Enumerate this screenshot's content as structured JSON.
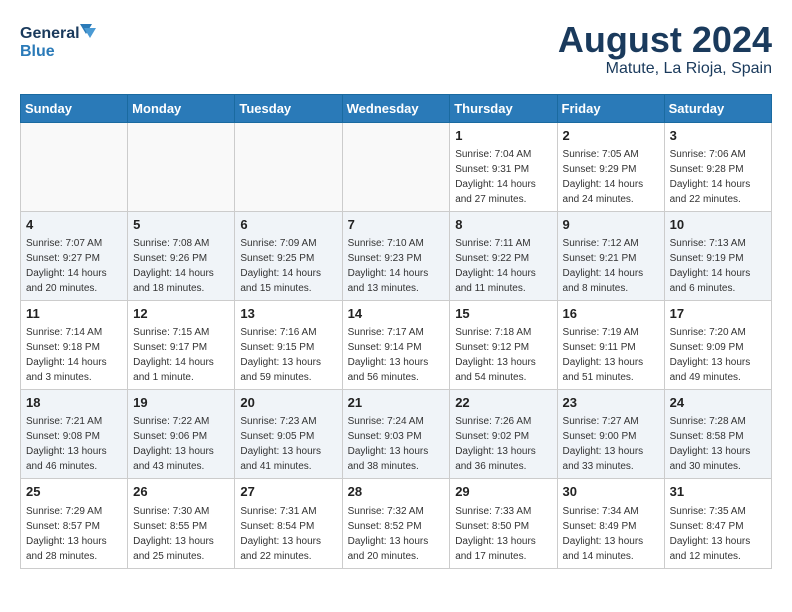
{
  "header": {
    "logo_general": "General",
    "logo_blue": "Blue",
    "month_year": "August 2024",
    "location": "Matute, La Rioja, Spain"
  },
  "weekdays": [
    "Sunday",
    "Monday",
    "Tuesday",
    "Wednesday",
    "Thursday",
    "Friday",
    "Saturday"
  ],
  "weeks": [
    [
      {
        "day": "",
        "sunrise": "",
        "sunset": "",
        "daylight": ""
      },
      {
        "day": "",
        "sunrise": "",
        "sunset": "",
        "daylight": ""
      },
      {
        "day": "",
        "sunrise": "",
        "sunset": "",
        "daylight": ""
      },
      {
        "day": "",
        "sunrise": "",
        "sunset": "",
        "daylight": ""
      },
      {
        "day": "1",
        "sunrise": "Sunrise: 7:04 AM",
        "sunset": "Sunset: 9:31 PM",
        "daylight": "Daylight: 14 hours and 27 minutes."
      },
      {
        "day": "2",
        "sunrise": "Sunrise: 7:05 AM",
        "sunset": "Sunset: 9:29 PM",
        "daylight": "Daylight: 14 hours and 24 minutes."
      },
      {
        "day": "3",
        "sunrise": "Sunrise: 7:06 AM",
        "sunset": "Sunset: 9:28 PM",
        "daylight": "Daylight: 14 hours and 22 minutes."
      }
    ],
    [
      {
        "day": "4",
        "sunrise": "Sunrise: 7:07 AM",
        "sunset": "Sunset: 9:27 PM",
        "daylight": "Daylight: 14 hours and 20 minutes."
      },
      {
        "day": "5",
        "sunrise": "Sunrise: 7:08 AM",
        "sunset": "Sunset: 9:26 PM",
        "daylight": "Daylight: 14 hours and 18 minutes."
      },
      {
        "day": "6",
        "sunrise": "Sunrise: 7:09 AM",
        "sunset": "Sunset: 9:25 PM",
        "daylight": "Daylight: 14 hours and 15 minutes."
      },
      {
        "day": "7",
        "sunrise": "Sunrise: 7:10 AM",
        "sunset": "Sunset: 9:23 PM",
        "daylight": "Daylight: 14 hours and 13 minutes."
      },
      {
        "day": "8",
        "sunrise": "Sunrise: 7:11 AM",
        "sunset": "Sunset: 9:22 PM",
        "daylight": "Daylight: 14 hours and 11 minutes."
      },
      {
        "day": "9",
        "sunrise": "Sunrise: 7:12 AM",
        "sunset": "Sunset: 9:21 PM",
        "daylight": "Daylight: 14 hours and 8 minutes."
      },
      {
        "day": "10",
        "sunrise": "Sunrise: 7:13 AM",
        "sunset": "Sunset: 9:19 PM",
        "daylight": "Daylight: 14 hours and 6 minutes."
      }
    ],
    [
      {
        "day": "11",
        "sunrise": "Sunrise: 7:14 AM",
        "sunset": "Sunset: 9:18 PM",
        "daylight": "Daylight: 14 hours and 3 minutes."
      },
      {
        "day": "12",
        "sunrise": "Sunrise: 7:15 AM",
        "sunset": "Sunset: 9:17 PM",
        "daylight": "Daylight: 14 hours and 1 minute."
      },
      {
        "day": "13",
        "sunrise": "Sunrise: 7:16 AM",
        "sunset": "Sunset: 9:15 PM",
        "daylight": "Daylight: 13 hours and 59 minutes."
      },
      {
        "day": "14",
        "sunrise": "Sunrise: 7:17 AM",
        "sunset": "Sunset: 9:14 PM",
        "daylight": "Daylight: 13 hours and 56 minutes."
      },
      {
        "day": "15",
        "sunrise": "Sunrise: 7:18 AM",
        "sunset": "Sunset: 9:12 PM",
        "daylight": "Daylight: 13 hours and 54 minutes."
      },
      {
        "day": "16",
        "sunrise": "Sunrise: 7:19 AM",
        "sunset": "Sunset: 9:11 PM",
        "daylight": "Daylight: 13 hours and 51 minutes."
      },
      {
        "day": "17",
        "sunrise": "Sunrise: 7:20 AM",
        "sunset": "Sunset: 9:09 PM",
        "daylight": "Daylight: 13 hours and 49 minutes."
      }
    ],
    [
      {
        "day": "18",
        "sunrise": "Sunrise: 7:21 AM",
        "sunset": "Sunset: 9:08 PM",
        "daylight": "Daylight: 13 hours and 46 minutes."
      },
      {
        "day": "19",
        "sunrise": "Sunrise: 7:22 AM",
        "sunset": "Sunset: 9:06 PM",
        "daylight": "Daylight: 13 hours and 43 minutes."
      },
      {
        "day": "20",
        "sunrise": "Sunrise: 7:23 AM",
        "sunset": "Sunset: 9:05 PM",
        "daylight": "Daylight: 13 hours and 41 minutes."
      },
      {
        "day": "21",
        "sunrise": "Sunrise: 7:24 AM",
        "sunset": "Sunset: 9:03 PM",
        "daylight": "Daylight: 13 hours and 38 minutes."
      },
      {
        "day": "22",
        "sunrise": "Sunrise: 7:26 AM",
        "sunset": "Sunset: 9:02 PM",
        "daylight": "Daylight: 13 hours and 36 minutes."
      },
      {
        "day": "23",
        "sunrise": "Sunrise: 7:27 AM",
        "sunset": "Sunset: 9:00 PM",
        "daylight": "Daylight: 13 hours and 33 minutes."
      },
      {
        "day": "24",
        "sunrise": "Sunrise: 7:28 AM",
        "sunset": "Sunset: 8:58 PM",
        "daylight": "Daylight: 13 hours and 30 minutes."
      }
    ],
    [
      {
        "day": "25",
        "sunrise": "Sunrise: 7:29 AM",
        "sunset": "Sunset: 8:57 PM",
        "daylight": "Daylight: 13 hours and 28 minutes."
      },
      {
        "day": "26",
        "sunrise": "Sunrise: 7:30 AM",
        "sunset": "Sunset: 8:55 PM",
        "daylight": "Daylight: 13 hours and 25 minutes."
      },
      {
        "day": "27",
        "sunrise": "Sunrise: 7:31 AM",
        "sunset": "Sunset: 8:54 PM",
        "daylight": "Daylight: 13 hours and 22 minutes."
      },
      {
        "day": "28",
        "sunrise": "Sunrise: 7:32 AM",
        "sunset": "Sunset: 8:52 PM",
        "daylight": "Daylight: 13 hours and 20 minutes."
      },
      {
        "day": "29",
        "sunrise": "Sunrise: 7:33 AM",
        "sunset": "Sunset: 8:50 PM",
        "daylight": "Daylight: 13 hours and 17 minutes."
      },
      {
        "day": "30",
        "sunrise": "Sunrise: 7:34 AM",
        "sunset": "Sunset: 8:49 PM",
        "daylight": "Daylight: 13 hours and 14 minutes."
      },
      {
        "day": "31",
        "sunrise": "Sunrise: 7:35 AM",
        "sunset": "Sunset: 8:47 PM",
        "daylight": "Daylight: 13 hours and 12 minutes."
      }
    ]
  ]
}
